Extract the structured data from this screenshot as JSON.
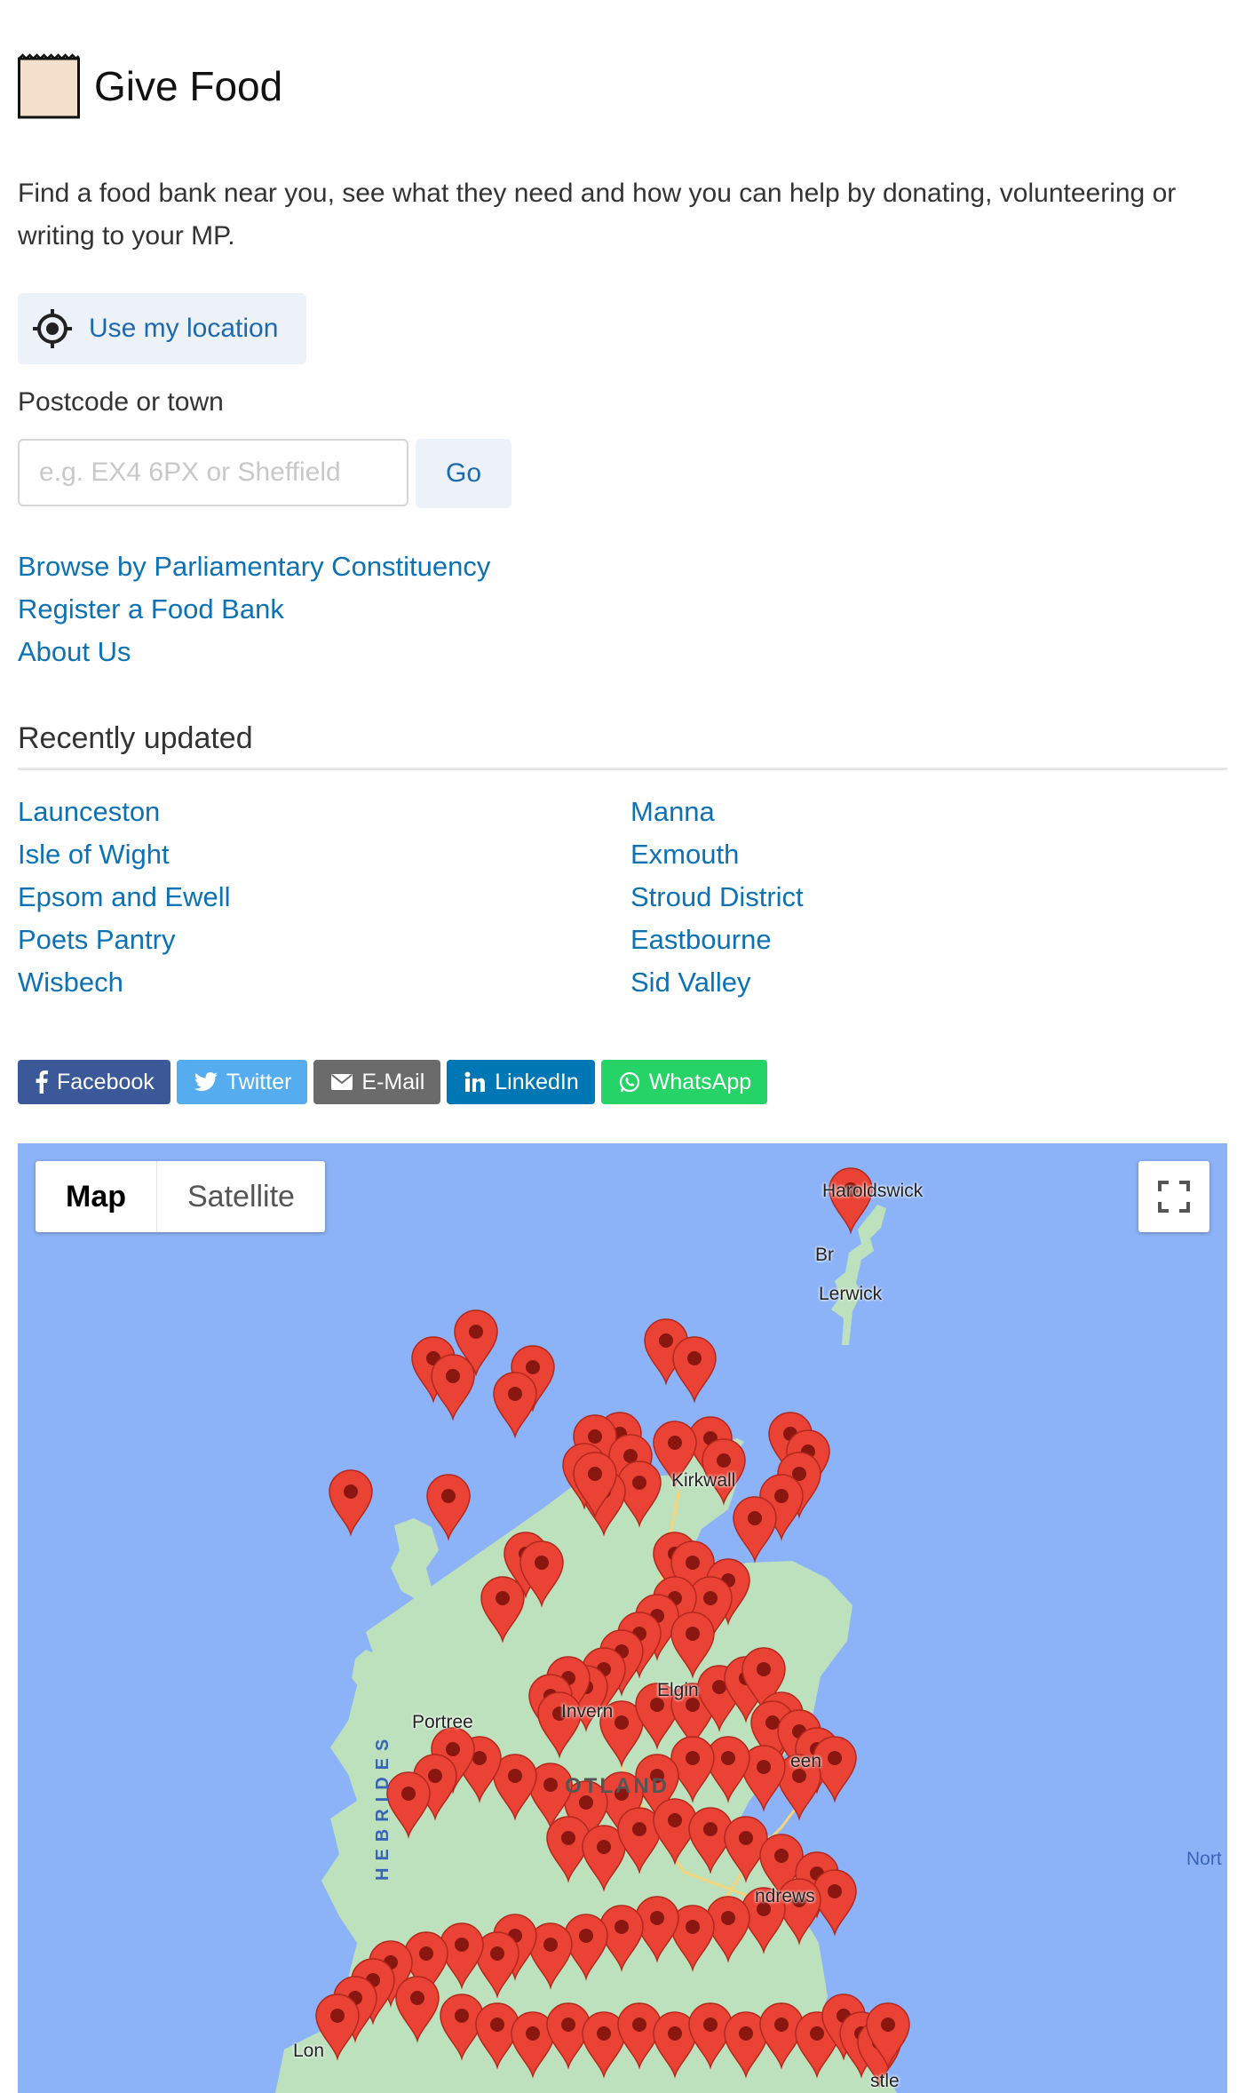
{
  "header": {
    "title": "Give Food",
    "logo_icon": "paper-bag-icon"
  },
  "intro": "Find a food bank near you, see what they need and how you can help by donating, volunteering or writing to your MP.",
  "location_button": {
    "label": "Use my location",
    "icon": "crosshair-icon"
  },
  "search": {
    "label": "Postcode or town",
    "placeholder": "e.g. EX4 6PX or Sheffield",
    "value": "",
    "button_label": "Go"
  },
  "links": [
    "Browse by Parliamentary Constituency",
    "Register a Food Bank",
    "About Us"
  ],
  "recent": {
    "heading": "Recently updated",
    "left": [
      "Launceston",
      "Isle of Wight",
      "Epsom and Ewell",
      "Poets Pantry",
      "Wisbech"
    ],
    "right": [
      "Manna",
      "Exmouth",
      "Stroud District",
      "Eastbourne",
      "Sid Valley"
    ]
  },
  "share": [
    {
      "label": "Facebook",
      "color": "#3b5998",
      "icon": "facebook-icon"
    },
    {
      "label": "Twitter",
      "color": "#55acee",
      "icon": "twitter-icon"
    },
    {
      "label": "E-Mail",
      "color": "#6b6b6b",
      "icon": "mail-icon"
    },
    {
      "label": "LinkedIn",
      "color": "#0077b5",
      "icon": "linkedin-icon"
    },
    {
      "label": "WhatsApp",
      "color": "#25d366",
      "icon": "whatsapp-icon"
    }
  ],
  "map": {
    "type_buttons": [
      "Map",
      "Satellite"
    ],
    "active_type": "Map",
    "fullscreen_icon": "fullscreen-icon",
    "labels": {
      "haroldswick": "Haroldswick",
      "brae": "Br",
      "lerwick": "Lerwick",
      "kirkwall": "Kirkwall",
      "portree": "Portree",
      "inverness": "Invern",
      "elgin": "Elgin",
      "aberdeen": "een",
      "scotland": "OTLAND",
      "hebrides": "HEBRIDES",
      "st_andrews": "ndrews",
      "londonderry": "Lon",
      "newcastle": "stle",
      "north_sea": "Nort"
    },
    "marker_color": "#ea4335"
  }
}
